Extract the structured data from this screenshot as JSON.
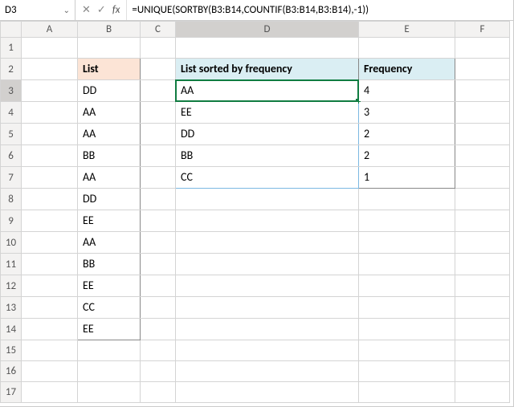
{
  "active_cell": "D3",
  "formula": "=UNIQUE(SORTBY(B3:B14,COUNTIF(B3:B14,B3:B14),-1))",
  "columns": [
    "A",
    "B",
    "C",
    "D",
    "E",
    "F"
  ],
  "rows": [
    "1",
    "2",
    "3",
    "4",
    "5",
    "6",
    "7",
    "8",
    "9",
    "10",
    "11",
    "12",
    "13",
    "14",
    "15",
    "16",
    "17"
  ],
  "headers": {
    "list": "List",
    "sorted": "List sorted by frequency",
    "freq": "Frequency"
  },
  "list_col": [
    "DD",
    "AA",
    "AA",
    "BB",
    "AA",
    "DD",
    "EE",
    "AA",
    "BB",
    "EE",
    "CC",
    "EE"
  ],
  "sorted_col": [
    "AA",
    "EE",
    "DD",
    "BB",
    "CC"
  ],
  "freq_col": [
    "4",
    "3",
    "2",
    "2",
    "1"
  ],
  "icons": {
    "chevron": "⌄",
    "cancel": "✕",
    "confirm": "✓",
    "fx": "fx"
  }
}
